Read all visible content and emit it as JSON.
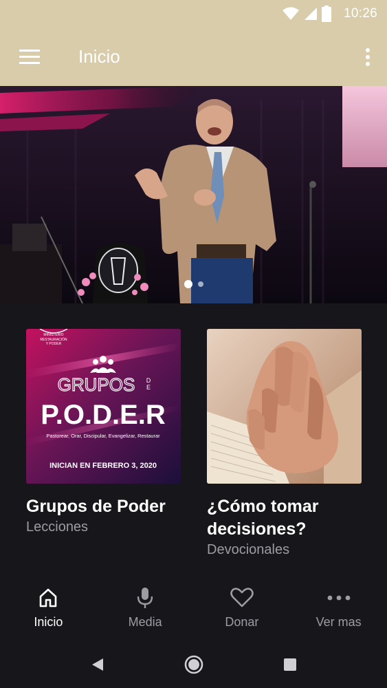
{
  "status_bar": {
    "time": "10:26",
    "icons": [
      "wifi-icon",
      "cell-signal-icon",
      "battery-icon"
    ]
  },
  "app_bar": {
    "title": "Inicio",
    "menu_icon": "hamburger-menu-icon",
    "overflow_icon": "more-vertical-icon"
  },
  "hero": {
    "description_icon": "speaker-photo",
    "slides": 2,
    "active_slide": 1
  },
  "cards": [
    {
      "title": "Grupos de Poder",
      "subtitle": "Lecciones",
      "poster": {
        "logo_line1": "MINISTERIO",
        "logo_line2": "RESTAURACIÓN",
        "logo_line3": "Y PODER",
        "grupos": "GRUPOS",
        "de_d": "D",
        "de_e": "E",
        "poder": "P.O.D.E.R",
        "tagline": "Pastorear, Orar, Discipular, Evangelizar, Restaurar",
        "date": "INICIAN EN FEBRERO  3, 2020"
      }
    },
    {
      "title": "¿Cómo tomar decisiones?",
      "subtitle": "Devocionales"
    }
  ],
  "bottom_nav": [
    {
      "label": "Inicio",
      "icon": "home-icon",
      "active": true
    },
    {
      "label": "Media",
      "icon": "microphone-icon",
      "active": false
    },
    {
      "label": "Donar",
      "icon": "heart-icon",
      "active": false
    },
    {
      "label": "Ver mas",
      "icon": "more-horizontal-icon",
      "active": false
    }
  ],
  "colors": {
    "app_bar": "#d8ccab",
    "background": "#17171b",
    "muted_text": "#9c9ca2",
    "poster_magenta": "#c2185b"
  }
}
